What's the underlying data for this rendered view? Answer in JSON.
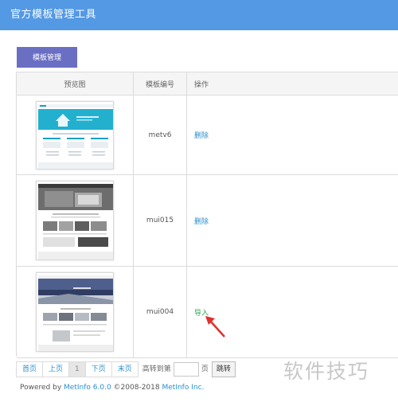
{
  "header": {
    "title": "官方模板管理工具"
  },
  "tabs": [
    {
      "label": "模板管理"
    }
  ],
  "table": {
    "columns": [
      "预览图",
      "模板编号",
      "操作"
    ],
    "rows": [
      {
        "template_id": "metv6",
        "action": "删除",
        "thumbnail": "template-preview-metv6"
      },
      {
        "template_id": "mui015",
        "action": "删除",
        "thumbnail": "template-preview-mui015"
      },
      {
        "template_id": "mui004",
        "action": "导入",
        "thumbnail": "template-preview-mui004"
      }
    ]
  },
  "pagination": {
    "first": "首页",
    "prev": "上页",
    "current": "1",
    "next": "下页",
    "last": "末页",
    "jump_label": "高转到第",
    "jump_unit": "页",
    "jump_button": "跳转"
  },
  "footer": {
    "powered": "Powered by",
    "product": "MetInfo 6.0.0",
    "copyright": "©2008-2018",
    "company": "MetInfo Inc."
  },
  "watermark": "软件技巧",
  "colors": {
    "titlebar": "#5499e4",
    "tab": "#6a6fc4",
    "link": "#2b8fcc",
    "import_link": "#27a94d",
    "arrow": "#e0312b"
  }
}
